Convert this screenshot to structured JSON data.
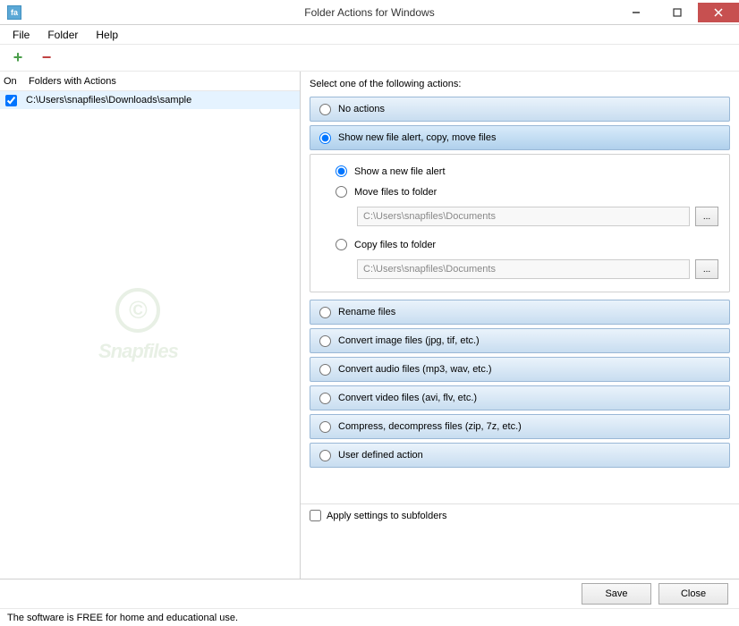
{
  "titlebar": {
    "icon_text": "fa",
    "title": "Folder Actions for Windows"
  },
  "menubar": {
    "file": "File",
    "folder": "Folder",
    "help": "Help"
  },
  "left": {
    "col_on": "On",
    "col_folders": "Folders with Actions",
    "folders": [
      {
        "checked": true,
        "path": "C:\\Users\\snapfiles\\Downloads\\sample"
      }
    ]
  },
  "right": {
    "title": "Select one of the following actions:",
    "options": {
      "no_actions": "No actions",
      "show_alert": "Show new file alert, copy, move files",
      "rename": "Rename files",
      "convert_image": "Convert image files (jpg, tif, etc.)",
      "convert_audio": "Convert audio files (mp3, wav, etc.)",
      "convert_video": "Convert video files (avi, flv, etc.)",
      "compress": "Compress, decompress files (zip, 7z, etc.)",
      "user_defined": "User defined action"
    },
    "sub": {
      "show_alert": "Show a new file alert",
      "move_files": "Move files to folder",
      "move_path": "C:\\Users\\snapfiles\\Documents",
      "copy_files": "Copy files to folder",
      "copy_path": "C:\\Users\\snapfiles\\Documents",
      "browse": "..."
    },
    "apply_subfolders": "Apply settings to subfolders"
  },
  "buttons": {
    "save": "Save",
    "close": "Close"
  },
  "statusbar": "The software is FREE for home and educational use.",
  "watermark": {
    "copyright": "©",
    "brand": "Snapfiles"
  }
}
